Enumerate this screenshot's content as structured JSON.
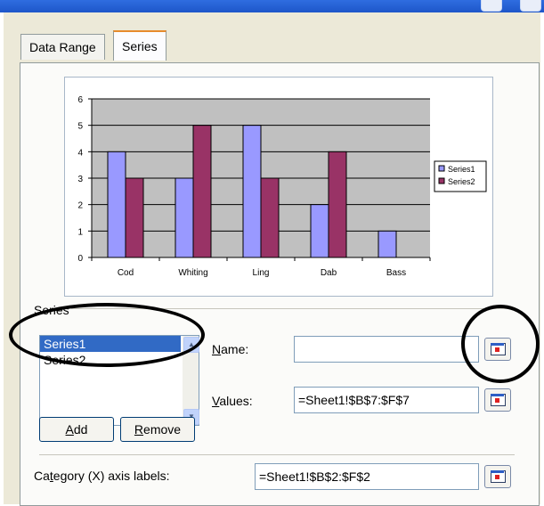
{
  "tabs": [
    {
      "label": "Data Range",
      "active": false
    },
    {
      "label": "Series",
      "active": true
    }
  ],
  "chart_data": {
    "type": "bar",
    "categories": [
      "Cod",
      "Whiting",
      "Ling",
      "Dab",
      "Bass"
    ],
    "series": [
      {
        "name": "Series1",
        "values": [
          4,
          3,
          5,
          2,
          1
        ],
        "color": "#9999ff"
      },
      {
        "name": "Series2",
        "values": [
          3,
          5,
          3,
          4,
          0
        ],
        "color": "#993366"
      }
    ],
    "ylim": [
      0,
      6
    ],
    "yticks": [
      "0",
      "1",
      "2",
      "3",
      "4",
      "5",
      "6"
    ],
    "grid": true,
    "legend": "right",
    "plot_background": "#c0c0c0"
  },
  "series_section": {
    "heading": "Series",
    "list": [
      "Series1",
      "Series2"
    ],
    "selected_index": 0,
    "name_label": "Name:",
    "name_value": "",
    "values_label": "Values:",
    "values_value": "=Sheet1!$B$7:$F$7",
    "add_label": "Add",
    "remove_label": "Remove"
  },
  "category_axis": {
    "label": "Category (X) axis labels:",
    "value": "=Sheet1!$B$2:$F$2"
  }
}
